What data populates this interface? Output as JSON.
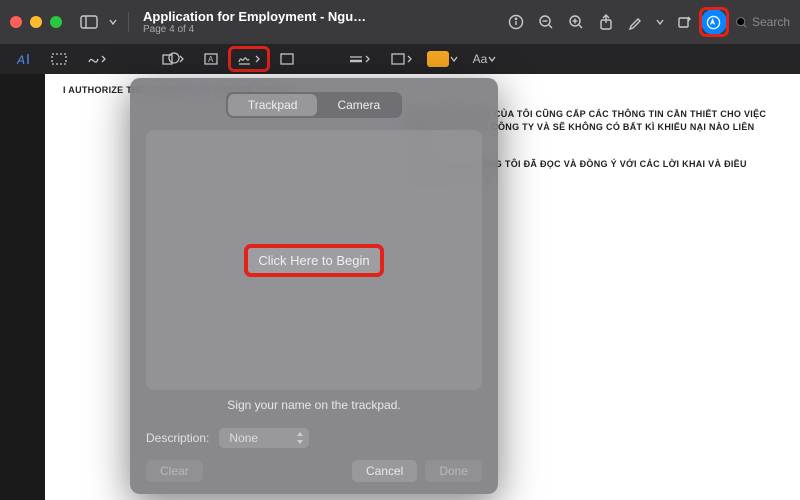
{
  "header": {
    "title": "Application for Employment - Nguyen Le...",
    "subtitle": "Page 4 of 4",
    "search_placeholder": "Search"
  },
  "toolbar2": {
    "fill_color": "#f5a623",
    "font_label": "Aa"
  },
  "sheet": {
    "tabs": {
      "trackpad": "Trackpad",
      "camera": "Camera"
    },
    "begin": "Click Here to Begin",
    "instruction": "Sign your name on the trackpad.",
    "desc_label": "Description:",
    "desc_value": "None",
    "buttons": {
      "clear": "Clear",
      "cancel": "Cancel",
      "done": "Done"
    }
  },
  "doc": {
    "line1": "I AUTHORIZE THE COMPANY TO INQUIRE INTO MY",
    "p1": "DỤNG TRƯỚC ĐÂY CỦA TÔI CŨNG CẤP CÁC THÔNG TIN CẦN THIẾT CHO VIỆC TUYỂN DỤNG CỦA CÔNG TY VÀ SẼ KHÔNG CÓ BẤT KÌ KHIẾU NẠI NÀO LIÊN QUAN.",
    "p2": "TÔI XÁC NHẬN RẰNG TÔI ĐÃ ĐỌC VÀ ĐỒNG Ý VỚI CÁC LỜI KHAI VÀ ĐIỀU KHOẢN NÊU TRÊN."
  }
}
